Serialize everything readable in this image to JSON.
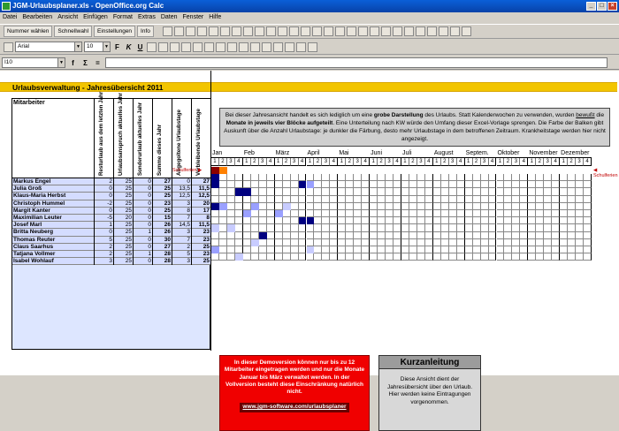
{
  "window": {
    "title": "JGM-Urlaubsplaner.xls - OpenOffice.org Calc"
  },
  "menu": [
    "Datei",
    "Bearbeiten",
    "Ansicht",
    "Einfügen",
    "Format",
    "Extras",
    "Daten",
    "Fenster",
    "Hilfe"
  ],
  "toolbar": {
    "btn1": "Nummer wählen",
    "btn2": "Schnellwahl",
    "btn3": "Einstellungen",
    "btn4": "Info"
  },
  "format": {
    "font": "Arial",
    "size": "10"
  },
  "namebox": "I10",
  "sheet": {
    "title": "Urlaubsverwaltung - Jahresübersicht 2011",
    "mitarbeiter_label": "Mitarbeiter",
    "columns": [
      "Resturlaub aus dem letzten Jahr",
      "Urlaubsanspruch aktuelles Jahr",
      "Sonderurlaub aktuelles Jahr",
      "Summe dieses Jahr",
      "Abgegoltene Urlaubstage",
      "Verbleibende Urlaubstage"
    ],
    "rows": [
      {
        "name": "Markus Engel",
        "v": [
          "2",
          "25",
          "0",
          "27",
          "0",
          "27"
        ]
      },
      {
        "name": "Julia Groß",
        "v": [
          "0",
          "25",
          "0",
          "25",
          "13,5",
          "11,5"
        ]
      },
      {
        "name": "Klaus-Maria Herbst",
        "v": [
          "0",
          "25",
          "0",
          "25",
          "12,5",
          "12,5"
        ]
      },
      {
        "name": "Christoph Hummel",
        "v": [
          "-2",
          "25",
          "0",
          "23",
          "3",
          "20"
        ]
      },
      {
        "name": "Margit Kanter",
        "v": [
          "0",
          "25",
          "0",
          "25",
          "8",
          "17"
        ]
      },
      {
        "name": "Maximilian Leuter",
        "v": [
          "-5",
          "20",
          "0",
          "15",
          "7",
          "8"
        ]
      },
      {
        "name": "Josef Marl",
        "v": [
          "1",
          "25",
          "0",
          "26",
          "14,5",
          "11,5"
        ]
      },
      {
        "name": "Britta Neuberg",
        "v": [
          "0",
          "25",
          "1",
          "26",
          "3",
          "23"
        ]
      },
      {
        "name": "Thomas Reuter",
        "v": [
          "5",
          "25",
          "0",
          "30",
          "7",
          "23"
        ]
      },
      {
        "name": "Claus Saarhus",
        "v": [
          "2",
          "25",
          "0",
          "27",
          "2",
          "25"
        ]
      },
      {
        "name": "Tatjana Vollmer",
        "v": [
          "2",
          "25",
          "1",
          "28",
          "5",
          "23"
        ]
      },
      {
        "name": "Isabel Wohlauf",
        "v": [
          "3",
          "25",
          "0",
          "28",
          "3",
          "25"
        ]
      }
    ],
    "infobox": {
      "t1": "Bei dieser Jahresansicht handelt es sich lediglich um eine ",
      "b1": "grobe Darstellung",
      "t2": " des Urlaubs. Statt Kalenderwochen zu verwenden, wurden ",
      "u1": "bewußt",
      "t3": " die ",
      "b2": "Monate in jeweils vier Blöcke aufgeteilt",
      "t4": ". Eine Unterteilung nach KW würde den Umfang dieser Excel-Vorlage sprengen. Die Farbe der Balken gibt Auskunft über die Anzahl Urlaubstage: je dunkler die Färbung, desto mehr Urlaubstage in dem betroffenen Zeitraum. Krankheitstage werden hier nicht angezeigt."
    },
    "months": [
      "Jan",
      "Feb",
      "März",
      "April",
      "Mai",
      "Juni",
      "Juli",
      "August",
      "Septem.",
      "Oktober",
      "November",
      "Dezember"
    ],
    "week_labels": [
      "1",
      "2",
      "3",
      "4"
    ],
    "schulferien": "Schulferien ▶",
    "schulferien_right": "◀ Schulferien",
    "demo": {
      "text": "In dieser Demoversion können nur bis zu 12 Mitarbeiter eingetragen werden und nur die Monate Januar bis März verwaltet werden. In der Vollversion besteht diese Einschränkung natürlich nicht.",
      "link": "www.jgm-software.com/urlaubsplaner"
    },
    "kurz": {
      "title": "Kurzanleitung",
      "text": "Diese Ansicht dient der Jahresübersicht über den Urlaub. Hier werden keine Eintragungen vorgenommen."
    }
  },
  "bars": [
    {
      "row": -1,
      "col": 0,
      "color": "#8b0000"
    },
    {
      "row": -1,
      "col": 1,
      "color": "#ff8000"
    },
    {
      "row": 0,
      "col": 0,
      "color": "#000080"
    },
    {
      "row": 1,
      "col": 0,
      "color": "#000080"
    },
    {
      "row": 1,
      "col": 11,
      "color": "#000080"
    },
    {
      "row": 1,
      "col": 12,
      "color": "#9aa0ff"
    },
    {
      "row": 2,
      "col": 3,
      "color": "#000080"
    },
    {
      "row": 2,
      "col": 4,
      "color": "#000080"
    },
    {
      "row": 4,
      "col": 0,
      "color": "#000080"
    },
    {
      "row": 4,
      "col": 1,
      "color": "#9aa0ff"
    },
    {
      "row": 4,
      "col": 5,
      "color": "#9aa0ff"
    },
    {
      "row": 4,
      "col": 9,
      "color": "#c8ccff"
    },
    {
      "row": 5,
      "col": 4,
      "color": "#9aa0ff"
    },
    {
      "row": 5,
      "col": 8,
      "color": "#9aa0ff"
    },
    {
      "row": 6,
      "col": 11,
      "color": "#000080"
    },
    {
      "row": 6,
      "col": 12,
      "color": "#000080"
    },
    {
      "row": 7,
      "col": 0,
      "color": "#c8ccff"
    },
    {
      "row": 7,
      "col": 2,
      "color": "#c8ccff"
    },
    {
      "row": 8,
      "col": 6,
      "color": "#000080"
    },
    {
      "row": 9,
      "col": 5,
      "color": "#c8ccff"
    },
    {
      "row": 10,
      "col": 0,
      "color": "#9aa0ff"
    },
    {
      "row": 10,
      "col": 12,
      "color": "#c8ccff"
    },
    {
      "row": 11,
      "col": 3,
      "color": "#c8ccff"
    }
  ]
}
